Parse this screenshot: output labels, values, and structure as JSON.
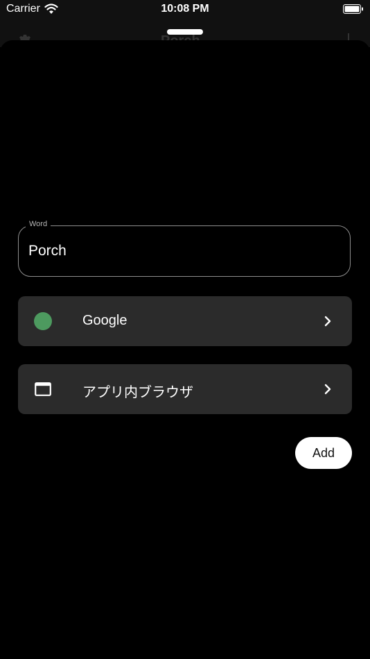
{
  "status_bar": {
    "carrier": "Carrier",
    "time": "10:08 PM"
  },
  "behind_header": {
    "title": "Porch"
  },
  "form": {
    "word_label": "Word",
    "word_value": "Porch"
  },
  "rows": [
    {
      "label": "Google",
      "icon": "colored-circle-icon",
      "color": "#4d9a5f"
    },
    {
      "label": "アプリ内ブラウザ",
      "icon": "browser-window-icon"
    }
  ],
  "add_button": {
    "label": "Add"
  },
  "colors": {
    "background": "#000000",
    "row_background": "#2b2b2b",
    "accent_green": "#4d9a5f",
    "border": "#8e8e8e"
  }
}
